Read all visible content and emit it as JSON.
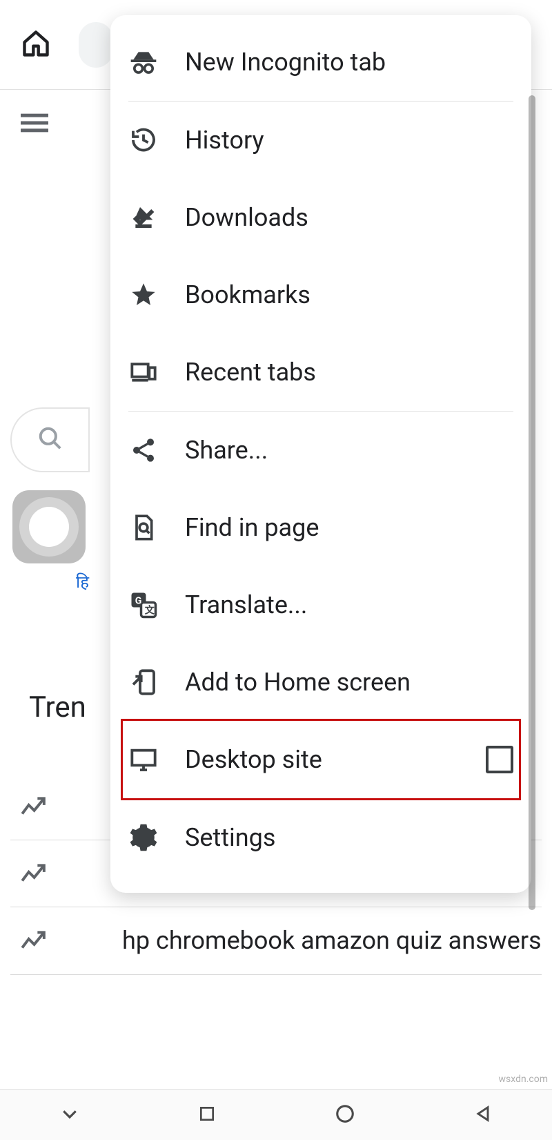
{
  "background": {
    "lang_text": "हि",
    "trending_header": "Tren",
    "trending_items": [
      {
        "text": ""
      },
      {
        "text": ""
      },
      {
        "text": "hp chromebook amazon quiz answers"
      }
    ]
  },
  "menu": {
    "incognito": "New Incognito tab",
    "history": "History",
    "downloads": "Downloads",
    "bookmarks": "Bookmarks",
    "recent_tabs": "Recent tabs",
    "share": "Share...",
    "find": "Find in page",
    "translate": "Translate...",
    "add_home": "Add to Home screen",
    "desktop_site": "Desktop site",
    "settings": "Settings"
  },
  "watermark": "wsxdn.com"
}
